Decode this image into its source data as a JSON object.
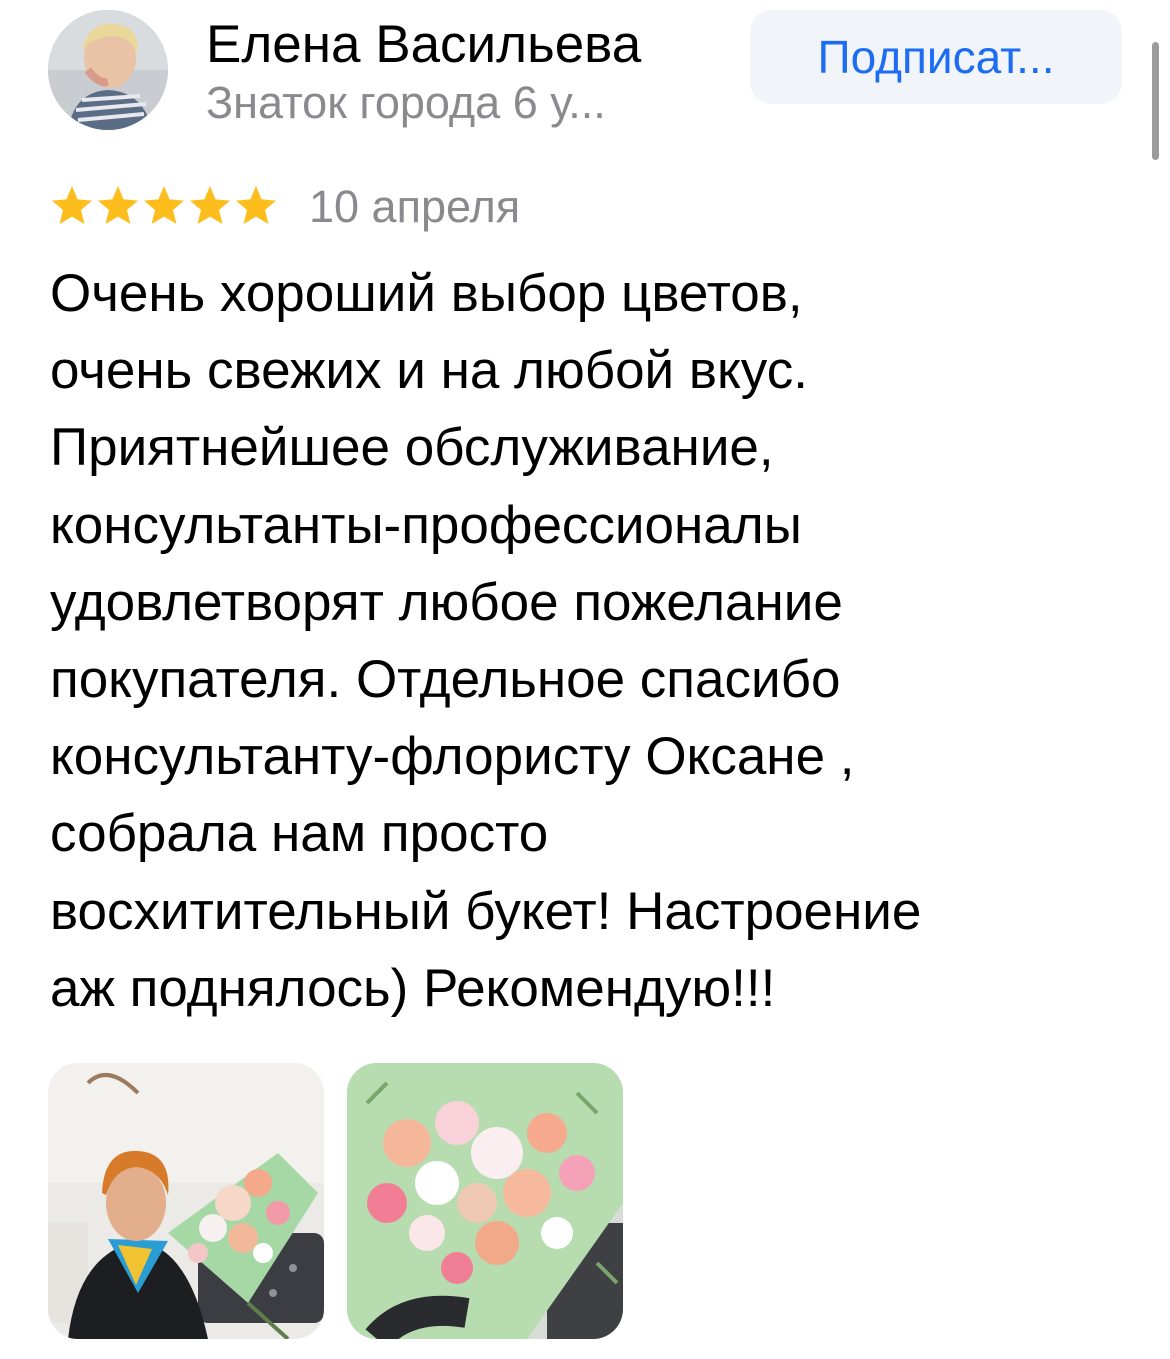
{
  "author": {
    "name": "Елена Васильева",
    "status": "Знаток города 6 у..."
  },
  "subscribe_label": "Подписат...",
  "review": {
    "rating": 5,
    "rating_max": 5,
    "date": "10 апреля",
    "lines": [
      "Очень хороший выбор цветов,",
      "очень свежих и на любой вкус.",
      "Приятнейшее обслуживание,",
      "консультанты-профессионалы",
      "удовлетворят любое пожелание",
      "покупателя. Отдельное спасибо",
      "консультанту-флористу Оксане ,",
      "собрала нам просто",
      "восхитительный букет! Настроение",
      "аж поднялось) Рекомендую!!!"
    ]
  },
  "colors": {
    "star": "#fdbd1c",
    "accent": "#1d6df3",
    "secondary_text": "#8a8a8e",
    "button_bg": "#f1f4f8"
  },
  "photos": [
    "woman-holding-bouquet-photo",
    "flower-bouquet-photo"
  ]
}
